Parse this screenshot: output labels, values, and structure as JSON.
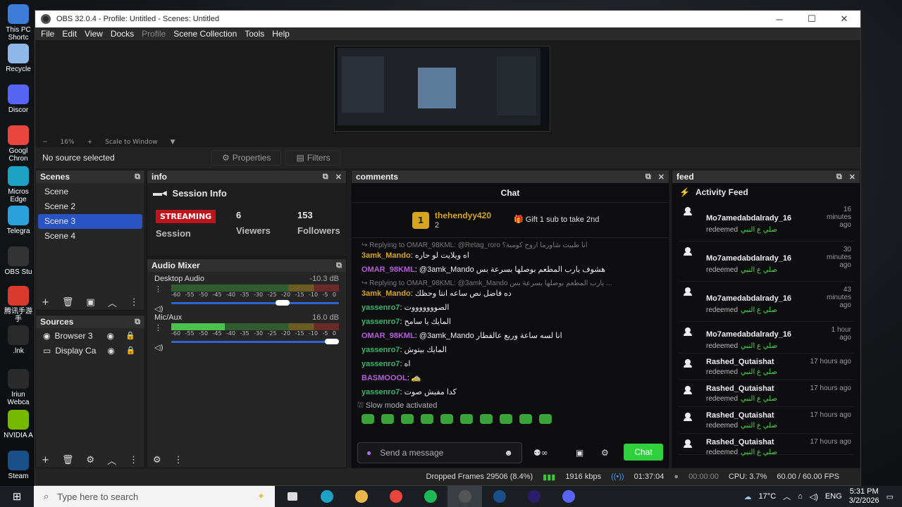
{
  "desktop_icons": [
    {
      "label": "This PC Shortc",
      "name": "this-pc-icon",
      "color": "#3b7dd8"
    },
    {
      "label": "Recycle",
      "name": "recycle-bin-icon",
      "color": "#8fb8e8"
    },
    {
      "label": "Discor",
      "name": "discord-icon",
      "color": "#5865f2"
    },
    {
      "label": "Googl Chron",
      "name": "chrome-icon",
      "color": "#e8453c"
    },
    {
      "label": "Micros Edge",
      "name": "edge-icon",
      "color": "#1da1c4"
    },
    {
      "label": "Telegra",
      "name": "telegram-icon",
      "color": "#2aa1d9"
    },
    {
      "label": "OBS Stu",
      "name": "obs-icon",
      "color": "#333333"
    },
    {
      "label": "腾讯手游 手",
      "name": "tencent-icon",
      "color": "#d83a2e"
    },
    {
      "label": ".lnk",
      "name": "shortcut-icon",
      "color": "#2a2a2a"
    },
    {
      "label": "Iriun Webca",
      "name": "iriun-icon",
      "color": "#2a2a2a"
    },
    {
      "label": "NVIDIA A",
      "name": "nvidia-icon",
      "color": "#76b900"
    },
    {
      "label": "Steam",
      "name": "steam-icon",
      "color": "#1b4f8a"
    }
  ],
  "window": {
    "title": "OBS 32.0.4 - Profile: Untitled - Scenes: Untitled",
    "minimize": "─",
    "maximize": "☐",
    "close": "✕"
  },
  "menu": [
    "File",
    "Edit",
    "View",
    "Docks",
    "Profile",
    "Scene Collection",
    "Tools",
    "Help"
  ],
  "zoom": {
    "minus": "−",
    "level": "16%",
    "plus": "+",
    "mode": "Scale to Window",
    "arrow": "▼"
  },
  "source_bar": {
    "no_source": "No source selected",
    "properties": "Properties",
    "filters": "Filters"
  },
  "scenes": {
    "title": "Scenes",
    "items": [
      "Scene",
      "Scene 2",
      "Scene 3",
      "Scene 4"
    ],
    "active_index": 2
  },
  "sources": {
    "title": "Sources",
    "items": [
      "Browser 3",
      "Display Ca"
    ]
  },
  "info": {
    "dock_title": "info",
    "title": "Session Info",
    "status": "STREAMING",
    "session_label": "Session",
    "viewers": "6",
    "viewers_label": "Viewers",
    "followers": "153",
    "followers_label": "Followers"
  },
  "mixer": {
    "title": "Audio Mixer",
    "ticks": [
      "-60",
      "-55",
      "-50",
      "-45",
      "-40",
      "-35",
      "-30",
      "-25",
      "-20",
      "-15",
      "-10",
      "-5",
      "0"
    ],
    "channels": [
      {
        "name": "Desktop Audio",
        "db": "-10.3 dB",
        "level": 0.0,
        "volume": 0.68
      },
      {
        "name": "Mic/Aux",
        "db": "16.0 dB",
        "level": 0.32,
        "volume": 1.0
      }
    ]
  },
  "comments": {
    "dock_title": "comments",
    "chat_title": "Chat",
    "pinned_user": "thehendyy420",
    "pinned_rank": "1",
    "pinned_count": "2",
    "gift_text": "Gift 1 sub to take 2nd",
    "messages": [
      {
        "reply": "↪ Replying to OMAR_98KML: @Retag_roro انا طبيت شاورما اروح كومبة؟",
        "user": "3amk_Mando",
        "color": "#d5a520",
        "text": ": اه ويلايت لو حاره"
      },
      {
        "reply": "",
        "user": "OMAR_98KML",
        "color": "#b45fd8",
        "text": ": @3amk_Mando هشوف يارب المطعم بوصلها بسرعة بس"
      },
      {
        "reply": "↪ Replying to OMAR_98KML: @3amk_Mando يارب المطعم بوصلها بسرعة بس ...",
        "user": "3amk_Mando",
        "color": "#d5a520",
        "text": ": ده فاضل نص ساعه انتا وحظك"
      },
      {
        "reply": "",
        "user": "yassenro7",
        "color": "#3cb371",
        "text": ": الصوووووووت"
      },
      {
        "reply": "",
        "user": "yassenro7",
        "color": "#3cb371",
        "text": ": المايك يا سامح"
      },
      {
        "reply": "",
        "user": "OMAR_98KML",
        "color": "#b45fd8",
        "text": ": @3amk_Mando انا لسه ساعة وربع عالفطار"
      },
      {
        "reply": "",
        "user": "yassenro7",
        "color": "#3cb371",
        "text": ": المايك بيتوش"
      },
      {
        "reply": "",
        "user": "yassenro7",
        "color": "#3cb371",
        "text": ": اه"
      },
      {
        "reply": "",
        "user": "BASMOOOL",
        "color": "#b45fd8",
        "text": ": 🚕"
      },
      {
        "reply": "",
        "user": "yassenro7",
        "color": "#3cb371",
        "text": ": كدا مفيش صوت"
      }
    ],
    "slow_mode": "Slow mode activated",
    "input_placeholder": "Send a message",
    "chat_button": "Chat"
  },
  "feed": {
    "dock_title": "feed",
    "title": "Activity Feed",
    "action": "redeemed",
    "reward": "صلي ع النبي",
    "items": [
      {
        "user": "Mo7amedabdalrady_16",
        "time": "16 minutes ago"
      },
      {
        "user": "Mo7amedabdalrady_16",
        "time": "30 minutes ago"
      },
      {
        "user": "Mo7amedabdalrady_16",
        "time": "43 minutes ago"
      },
      {
        "user": "Mo7amedabdalrady_16",
        "time": "1 hour ago"
      },
      {
        "user": "Rashed_Qutaishat",
        "time": "17 hours ago"
      },
      {
        "user": "Rashed_Qutaishat",
        "time": "17 hours ago"
      },
      {
        "user": "Rashed_Qutaishat",
        "time": "17 hours ago"
      },
      {
        "user": "Rashed_Qutaishat",
        "time": "17 hours ago"
      }
    ]
  },
  "status": {
    "dropped": "Dropped Frames 29506 (8.4%)",
    "bitrate": "1916 kbps",
    "stream_time": "01:37:04",
    "rec_time": "00:00:00",
    "cpu": "CPU: 3.7%",
    "fps": "60.00 / 60.00 FPS"
  },
  "taskbar": {
    "search_placeholder": "Type here to search",
    "weather": "17°C",
    "lang": "ENG",
    "time": "5:31 PM",
    "date": "3/2/2026",
    "apps": [
      {
        "name": "task-view-icon",
        "color": "#dddddd"
      },
      {
        "name": "edge-icon",
        "color": "#1da1c4"
      },
      {
        "name": "file-explorer-icon",
        "color": "#e8b84a"
      },
      {
        "name": "chrome-icon",
        "color": "#e8453c"
      },
      {
        "name": "spotify-icon",
        "color": "#1db954"
      },
      {
        "name": "obs-icon",
        "color": "#555555"
      },
      {
        "name": "steam-icon",
        "color": "#1b4f8a"
      },
      {
        "name": "premiere-icon",
        "color": "#2b1c6b"
      },
      {
        "name": "discord-icon",
        "color": "#5865f2"
      }
    ]
  }
}
